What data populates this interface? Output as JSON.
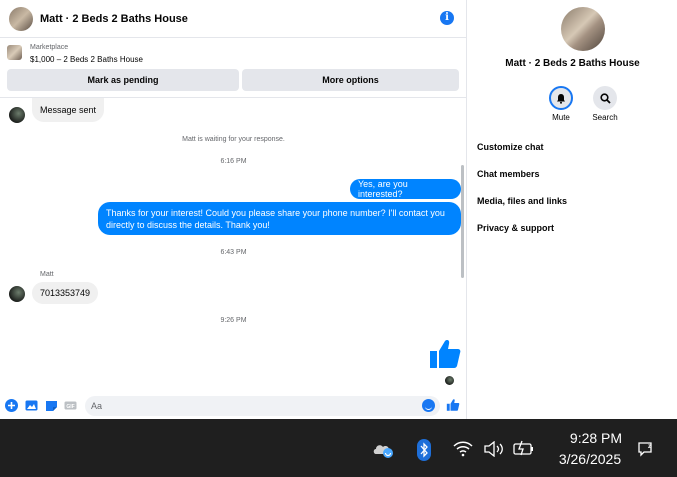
{
  "header": {
    "title": "Matt · 2 Beds 2 Baths House",
    "info_glyph": "i"
  },
  "listing": {
    "source": "Marketplace",
    "name": "$1,000 – 2 Beds 2 Baths House",
    "mark_pending_label": "Mark as pending",
    "more_options_label": "More options"
  },
  "thread": {
    "message_sent": "Message sent",
    "waiting_note": "Matt is waiting for your response.",
    "time_1": "6:16 PM",
    "outgoing_1": "Yes, are you interested?",
    "outgoing_2_line1": "Thanks for your interest! Could you please share your phone number? I'll contact you",
    "outgoing_2_line2": "directly to discuss the details. Thank you!",
    "time_2": "6:43 PM",
    "sender_name": "Matt",
    "incoming_phone": "7013353749",
    "time_3": "9:26 PM"
  },
  "composer": {
    "placeholder": "Aa"
  },
  "right_panel": {
    "title": "Matt · 2 Beds 2 Baths House",
    "mute_label": "Mute",
    "search_label": "Search",
    "items": [
      "Customize chat",
      "Chat members",
      "Media, files and links",
      "Privacy & support"
    ]
  },
  "taskbar": {
    "time": "9:28 PM",
    "date": "3/26/2025"
  },
  "colors": {
    "accent": "#0084ff",
    "brand": "#1877f2",
    "taskbar": "#1f1f1f"
  },
  "icons": [
    "info-icon",
    "bell-icon",
    "search-icon",
    "plus-icon",
    "image-icon",
    "sticker-icon",
    "gif-icon",
    "emoji-icon",
    "like-icon",
    "onedrive-icon",
    "bluetooth-icon",
    "wifi-icon",
    "volume-icon",
    "battery-icon",
    "notification-icon"
  ]
}
